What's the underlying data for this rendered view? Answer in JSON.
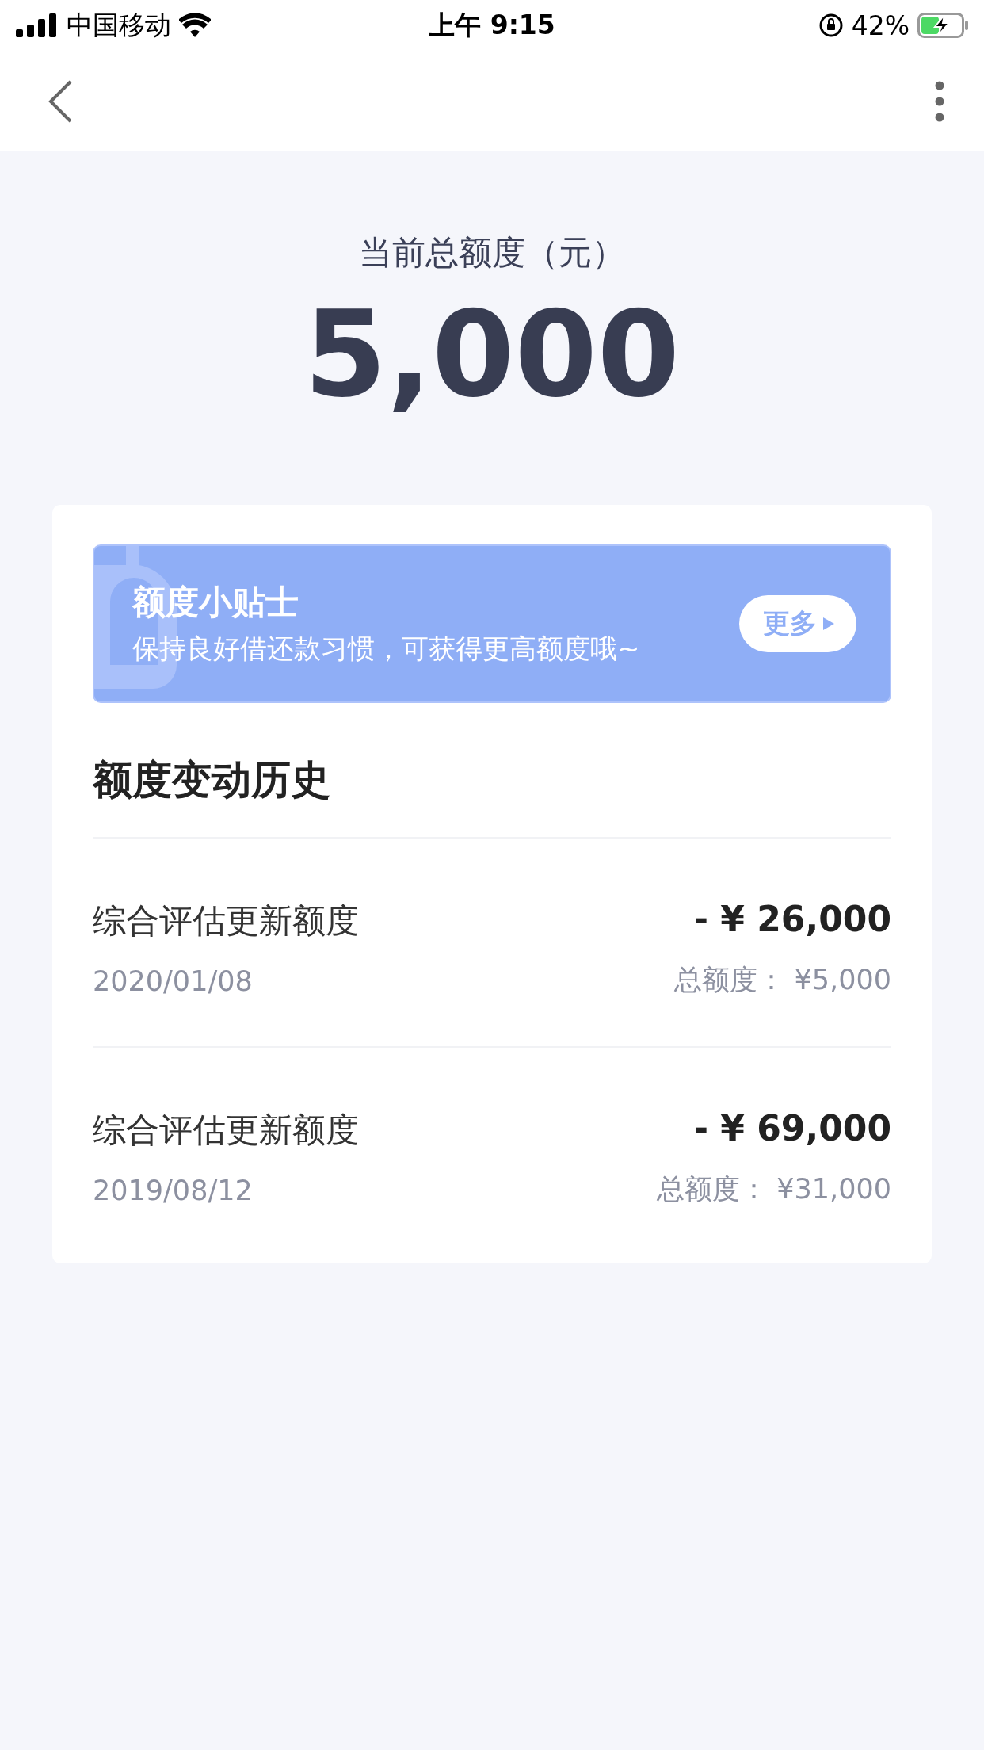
{
  "status_bar": {
    "carrier": "中国移动",
    "time": "上午 9:15",
    "battery": "42%",
    "charging": true
  },
  "header": {
    "label": "当前总额度（元）",
    "amount": "5,000"
  },
  "tip": {
    "title": "额度小贴士",
    "text": "保持良好借还款习惯，可获得更高额度哦~",
    "button": "更多"
  },
  "history": {
    "title": "额度变动历史",
    "rows": [
      {
        "name": "综合评估更新额度",
        "date": "2020/01/08",
        "change": "- ¥ 26,000",
        "total": "总额度： ¥5,000"
      },
      {
        "name": "综合评估更新额度",
        "date": "2019/08/12",
        "change": "- ¥ 69,000",
        "total": "总额度： ¥31,000"
      }
    ]
  }
}
